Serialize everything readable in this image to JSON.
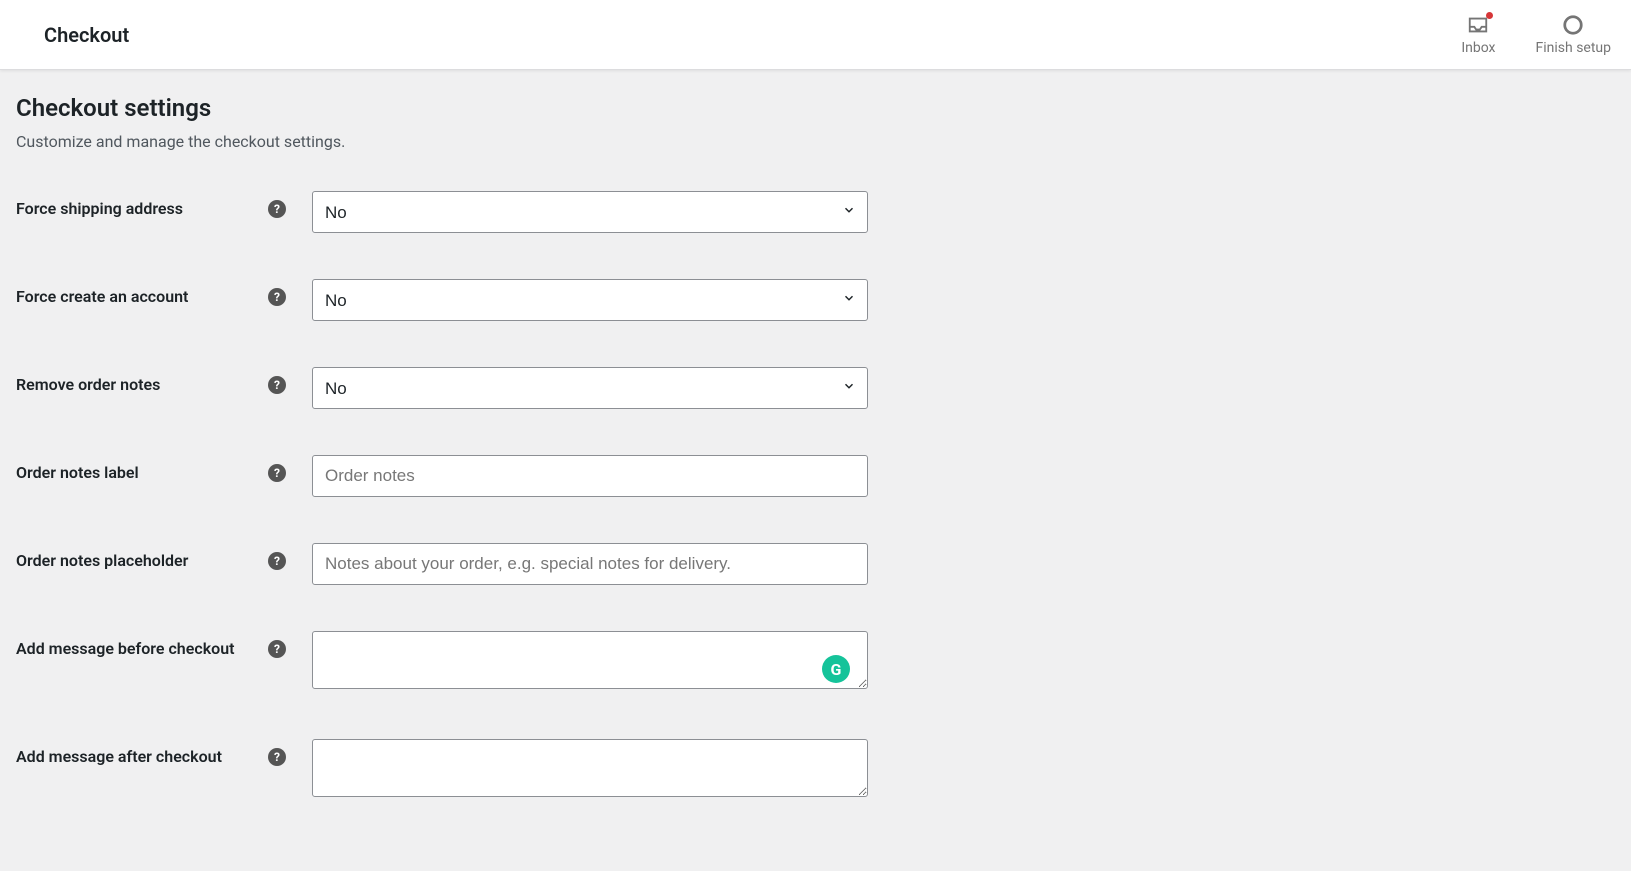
{
  "topbar": {
    "title": "Checkout",
    "inbox_label": "Inbox",
    "finish_label": "Finish setup"
  },
  "page": {
    "heading": "Checkout settings",
    "subheading": "Customize and manage the checkout settings."
  },
  "fields": {
    "force_shipping": {
      "label": "Force shipping address",
      "value": "No"
    },
    "force_account": {
      "label": "Force create an account",
      "value": "No"
    },
    "remove_notes": {
      "label": "Remove order notes",
      "value": "No"
    },
    "notes_label": {
      "label": "Order notes label",
      "placeholder": "Order notes",
      "value": ""
    },
    "notes_placeholder": {
      "label": "Order notes placeholder",
      "placeholder": "Notes about your order, e.g. special notes for delivery.",
      "value": ""
    },
    "msg_before": {
      "label": "Add message before checkout",
      "value": ""
    },
    "msg_after": {
      "label": "Add message after checkout",
      "value": ""
    }
  }
}
